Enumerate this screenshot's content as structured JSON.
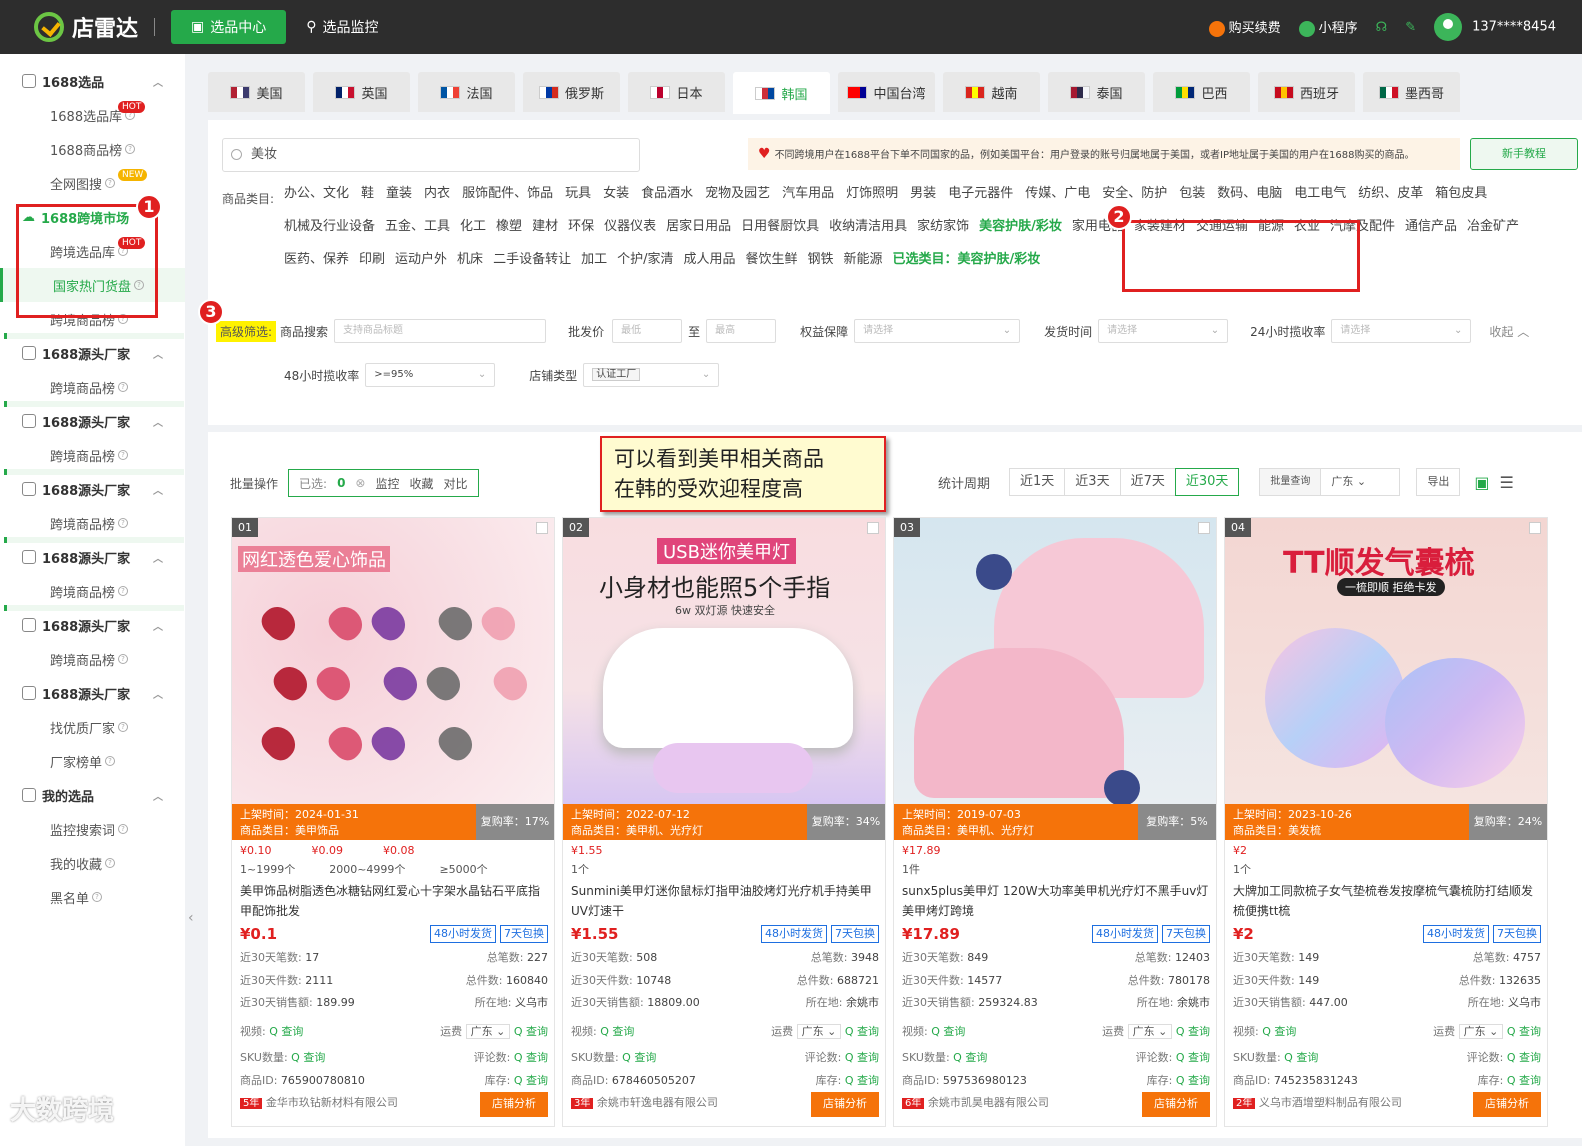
{
  "top": {
    "logo": "店雷达",
    "nav": [
      "选品中心",
      "选品监控"
    ],
    "right": [
      "购买续费",
      "小程序"
    ],
    "user": "137****8454"
  },
  "sidebar": [
    {
      "t": "g",
      "label": "1688选品"
    },
    {
      "t": "i",
      "label": "1688选品库",
      "badge": "HOT"
    },
    {
      "t": "i",
      "label": "1688商品榜"
    },
    {
      "t": "i",
      "label": "全网图搜",
      "badge": "NEW"
    },
    {
      "t": "h",
      "label": "1688跨境市场"
    },
    {
      "t": "i",
      "label": "跨境选品库",
      "badge": "HOT"
    },
    {
      "t": "a",
      "label": "国家热门货盘"
    },
    {
      "t": "i",
      "label": "跨境商品榜"
    },
    {
      "t": "g",
      "label": "1688源头厂家"
    },
    {
      "t": "i",
      "label": "跨境商品榜"
    },
    {
      "t": "g",
      "label": "1688源头厂家"
    },
    {
      "t": "i",
      "label": "跨境商品榜"
    },
    {
      "t": "g",
      "label": "1688源头厂家"
    },
    {
      "t": "i",
      "label": "跨境商品榜"
    },
    {
      "t": "g",
      "label": "1688源头厂家"
    },
    {
      "t": "i",
      "label": "跨境商品榜"
    },
    {
      "t": "g",
      "label": "1688源头厂家"
    },
    {
      "t": "i",
      "label": "跨境商品榜"
    },
    {
      "t": "g",
      "label": "1688源头厂家"
    },
    {
      "t": "i",
      "label": "找优质厂家"
    },
    {
      "t": "i",
      "label": "厂家榜单"
    },
    {
      "t": "g",
      "label": "我的选品"
    },
    {
      "t": "i",
      "label": "监控搜索词"
    },
    {
      "t": "i",
      "label": "我的收藏"
    },
    {
      "t": "i",
      "label": "黑名单"
    }
  ],
  "countries": [
    {
      "name": "美国",
      "c": [
        "#b22234",
        "#fff",
        "#3c3b6e"
      ]
    },
    {
      "name": "英国",
      "c": [
        "#012169",
        "#fff",
        "#c8102e"
      ]
    },
    {
      "name": "法国",
      "c": [
        "#0055a4",
        "#fff",
        "#ef4135"
      ]
    },
    {
      "name": "俄罗斯",
      "c": [
        "#fff",
        "#0039a6",
        "#d52b1e"
      ]
    },
    {
      "name": "日本",
      "c": [
        "#fff",
        "#bc002d",
        "#fff"
      ]
    },
    {
      "name": "韩国",
      "c": [
        "#fff",
        "#cd2e3a",
        "#0047a0"
      ]
    },
    {
      "name": "中国台湾",
      "c": [
        "#fe0000",
        "#fe0000",
        "#000095"
      ]
    },
    {
      "name": "越南",
      "c": [
        "#da251d",
        "#ffff00",
        "#da251d"
      ]
    },
    {
      "name": "泰国",
      "c": [
        "#a51931",
        "#2d2a4a",
        "#f4f5f8"
      ]
    },
    {
      "name": "巴西",
      "c": [
        "#009c3b",
        "#ffdf00",
        "#002776"
      ]
    },
    {
      "name": "西班牙",
      "c": [
        "#c60b1e",
        "#ffc400",
        "#c60b1e"
      ]
    },
    {
      "name": "墨西哥",
      "c": [
        "#006847",
        "#fff",
        "#ce1126"
      ]
    }
  ],
  "search": {
    "value": "美妆"
  },
  "notice": "不同跨境用户在1688平台下单不同国家的品，例如美国平台：用户登录的账号归属地属于美国，或者IP地址属于美国的用户在1688购买的商品。",
  "guide": "新手教程",
  "cat_label": "商品类目:",
  "categories": [
    "办公、文化",
    "鞋",
    "童装",
    "内衣",
    "服饰配件、饰品",
    "玩具",
    "女装",
    "食品酒水",
    "宠物及园艺",
    "汽车用品",
    "灯饰照明",
    "男装",
    "电子元器件",
    "传媒、广电",
    "安全、防护",
    "包装",
    "数码、电脑",
    "电工电气",
    "纺织、皮革",
    "箱包皮具",
    "机械及行业设备",
    "五金、工具",
    "化工",
    "橡塑",
    "建材",
    "环保",
    "仪器仪表",
    "居家日用品",
    "日用餐厨饮具",
    "收纳清洁用具",
    "家纺家饰",
    "美容护肤/彩妆",
    "家用电器",
    "家装建材",
    "交通运输",
    "能源",
    "农业",
    "汽摩及配件",
    "通信产品",
    "冶金矿产",
    "医药、保养",
    "印刷",
    "运动户外",
    "机床",
    "二手设备转让",
    "加工",
    "个护/家清",
    "成人用品",
    "餐饮生鲜",
    "钢铁",
    "新能源"
  ],
  "selected_cat": "已选类目：美容护肤/彩妆",
  "filters": {
    "adv": "高级筛选:",
    "search_label": "商品搜索",
    "search_ph": "支持商品标题",
    "price_label": "批发价",
    "min": "最低",
    "to": "至",
    "max": "最高",
    "rights": "权益保障",
    "please": "请选择",
    "ship": "发货时间",
    "rate24": "24小时揽收率",
    "collapse": "收起",
    "rate48": "48小时揽收率",
    "rate48v": ">=95%",
    "shoptype": "店铺类型",
    "shoptypev": "认证工厂"
  },
  "batch": {
    "label": "批量操作",
    "sel": "已选:",
    "count": "0",
    "actions": [
      "监控",
      "收藏",
      "对比"
    ]
  },
  "callout": [
    "可以看到美甲相关商品",
    "在韩的受欢迎程度高"
  ],
  "period": {
    "label": "统计周期",
    "opts": [
      "近1天",
      "近3天",
      "近7天",
      "近30天"
    ],
    "batch": "批量查询",
    "region": "广东",
    "export": "导出"
  },
  "products": [
    {
      "rank": "01",
      "img_title": "网红透色爱心饰品",
      "date": "上架时间：2024-01-31",
      "cat": "商品类目：美甲饰品",
      "rebuy": "复购率：17%",
      "prices": [
        "¥0.10",
        "¥0.09",
        "¥0.08"
      ],
      "qtys": [
        "1~1999个",
        "2000~4999个",
        "≥5000个"
      ],
      "title": "美甲饰品树脂透色冰糖钻网红爱心十字架水晶钻石平底指甲配饰批发",
      "big": "¥0.1",
      "s30": "17",
      "total": "227",
      "b30": "2111",
      "tb": "160840",
      "sale": "189.99",
      "loc": "义乌市",
      "id": "765900780810",
      "yrs": "5年",
      "shop": "金华市玖钻新材料有限公司"
    },
    {
      "rank": "02",
      "img_title": "USB迷你美甲灯",
      "img_sub": "小身材也能照5个手指",
      "img_sub2": "6w 双灯源 快速安全",
      "date": "上架时间：2022-07-12",
      "cat": "商品类目：美甲机、光疗灯",
      "rebuy": "复购率：34%",
      "prices": [
        "¥1.55"
      ],
      "qtys": [
        "1个"
      ],
      "title": "Sunmini美甲灯迷你鼠标灯指甲油胶烤灯光疗机手持美甲UV灯速干",
      "big": "¥1.55",
      "s30": "508",
      "total": "3948",
      "b30": "10748",
      "tb": "688721",
      "sale": "18809.00",
      "loc": "余姚市",
      "id": "678460505207",
      "yrs": "3年",
      "shop": "余姚市轩逸电器有限公司"
    },
    {
      "rank": "03",
      "date": "上架时间：2019-07-03",
      "cat": "商品类目：美甲机、光疗灯",
      "rebuy": "复购率：5%",
      "prices": [
        "¥17.89"
      ],
      "qtys": [
        "1件"
      ],
      "title": "sunx5plus美甲灯 120W大功率美甲机光疗灯不黑手uv灯美甲烤灯跨境",
      "big": "¥17.89",
      "s30": "849",
      "total": "12403",
      "b30": "14577",
      "tb": "780178",
      "sale": "259324.83",
      "loc": "余姚市",
      "id": "597536980123",
      "yrs": "6年",
      "shop": "余姚市凯昊电器有限公司"
    },
    {
      "rank": "04",
      "img_title": "TT顺发气囊梳",
      "img_sub": "一梳即顺 拒绝卡发",
      "date": "上架时间：2023-10-26",
      "cat": "商品类目：美发梳",
      "rebuy": "复购率：24%",
      "prices": [
        "¥2"
      ],
      "qtys": [
        "1个"
      ],
      "title": "大牌加工同款梳子女气垫梳卷发按摩梳气囊梳防打结顺发梳便携tt梳",
      "big": "¥2",
      "s30": "149",
      "total": "4757",
      "b30": "149",
      "tb": "132635",
      "sale": "447.00",
      "loc": "义乌市",
      "id": "745235831243",
      "yrs": "2年",
      "shop": "义乌市酒增塑料制品有限公司"
    }
  ],
  "labels": {
    "tag1": "48小时发货",
    "tag2": "7天包换",
    "s30": "近30天笔数:",
    "total": "总笔数:",
    "b30": "近30天件数:",
    "tb": "总件数:",
    "sale": "近30天销售额:",
    "loc": "所在地:",
    "video": "视频:",
    "freight": "运费",
    "region": "广东",
    "sku": "SKU数量:",
    "review": "评论数:",
    "pid": "商品ID:",
    "stock": "库存:",
    "query": "查询",
    "shopbtn": "店铺分析"
  },
  "watermark": "大数跨境"
}
